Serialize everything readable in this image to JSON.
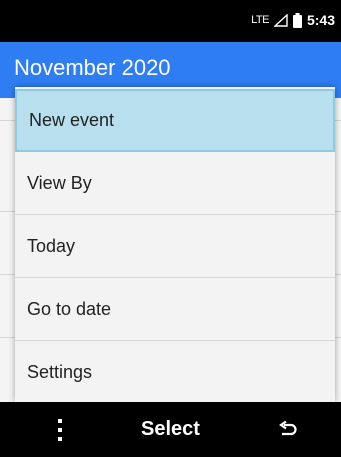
{
  "status_bar": {
    "network_label": "LTE",
    "signal_icon": "signal-icon",
    "battery_icon": "battery-icon",
    "time": "5:43"
  },
  "header": {
    "title": "November 2020"
  },
  "menu": {
    "items": [
      {
        "label": "New event",
        "selected": true
      },
      {
        "label": "View By",
        "selected": false
      },
      {
        "label": "Today",
        "selected": false
      },
      {
        "label": "Go to date",
        "selected": false
      },
      {
        "label": "Settings",
        "selected": false
      }
    ]
  },
  "softkeys": {
    "left_icon": "more-options-icon",
    "center_label": "Select",
    "right_icon": "back-icon"
  },
  "colors": {
    "header_bg": "#2f7df3",
    "selected_item_bg": "#b7dfee",
    "menu_bg": "#f3f3f3"
  }
}
